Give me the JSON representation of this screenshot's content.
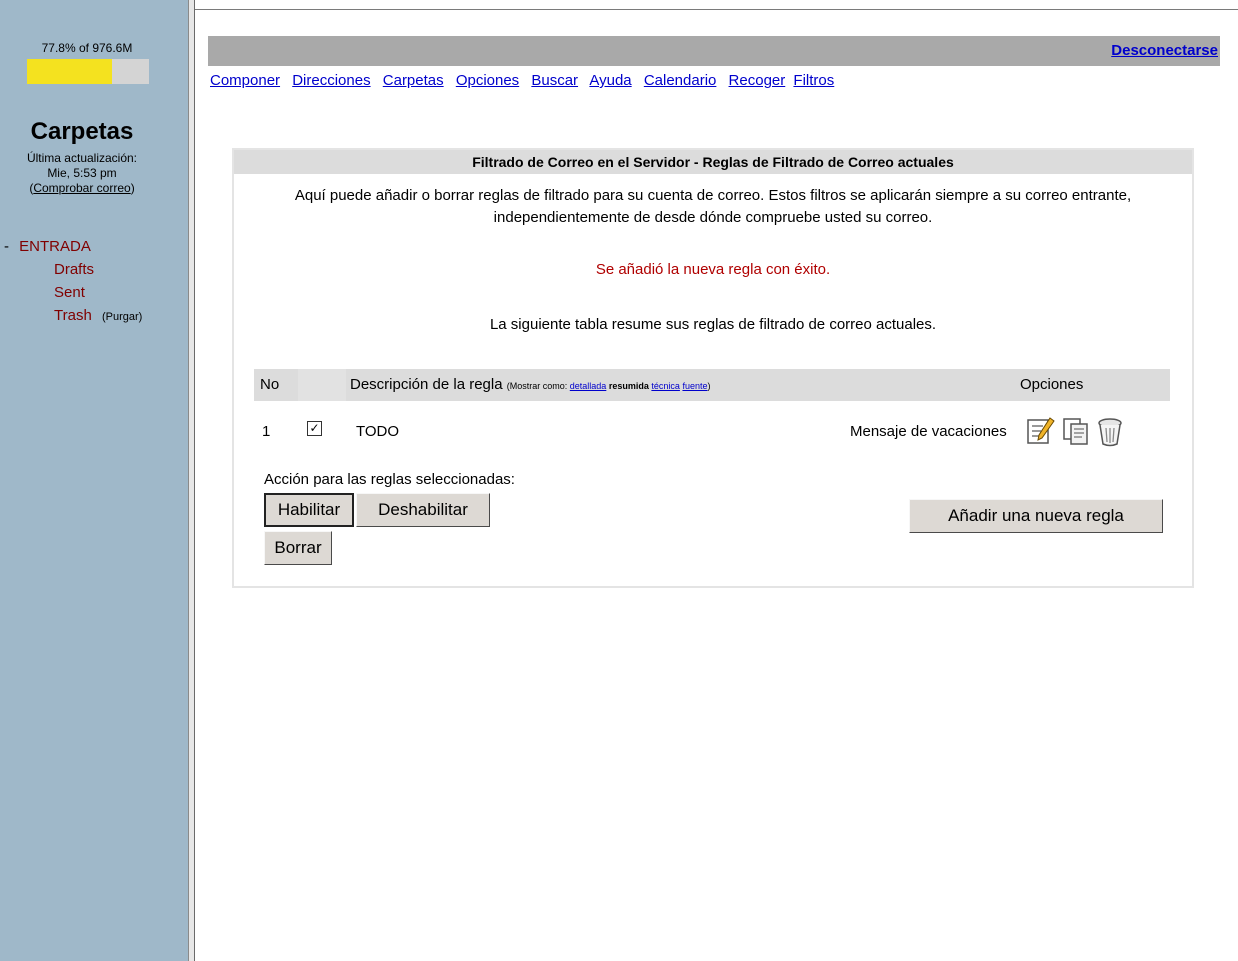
{
  "sidebar": {
    "quota_text": "77.8% of 976.6M",
    "quota_used_fraction": 0.778,
    "folders_title": "Carpetas",
    "last_update_label": "Última actualización:",
    "last_update_time": "Mie, 5:53 pm",
    "check_mail_open": "(",
    "check_mail_link": "Comprobar correo",
    "check_mail_close": ")",
    "collapse_symbol": "-",
    "folders": [
      {
        "label": "ENTRADA"
      },
      {
        "label": "Drafts"
      },
      {
        "label": "Sent"
      },
      {
        "label": "Trash",
        "purge_label": "Purgar"
      }
    ]
  },
  "header": {
    "logout_label": "Desconectarse"
  },
  "menu": [
    {
      "label": "Componer"
    },
    {
      "label": "Direcciones"
    },
    {
      "label": "Carpetas"
    },
    {
      "label": "Opciones"
    },
    {
      "label": "Buscar"
    },
    {
      "label": "Ayuda"
    },
    {
      "label": "Calendario"
    },
    {
      "label": "Recoger"
    },
    {
      "label": "Filtros"
    }
  ],
  "filters": {
    "title": "Filtrado de Correo en el Servidor - Reglas de Filtrado de Correo actuales",
    "intro_line1": "Aquí puede añadir o borrar reglas de filtrado para su cuenta de correo. Estos filtros se aplicarán siempre a su correo entrante,",
    "intro_line2": "independientemente de desde dónde compruebe usted su correo.",
    "success_message": "Se añadió la nueva regla con éxito.",
    "summary_text": "La siguiente tabla resume sus reglas de filtrado de correo actuales.",
    "table": {
      "col_no": "No",
      "col_description": "Descripción de la regla",
      "show_as_label": "(Mostrar como:",
      "view_detailed": "detallada",
      "view_summary": "resumida",
      "view_technical": "técnica",
      "view_source": "fuente",
      "show_as_close": ")",
      "col_options": "Opciones"
    },
    "rules": [
      {
        "no": "1",
        "checked": true,
        "name": "TODO",
        "action": "Mensaje de vacaciones"
      }
    ],
    "selected_actions_label": "Acción para las reglas seleccionadas:",
    "btn_enable": "Habilitar",
    "btn_disable": "Deshabilitar",
    "btn_delete": "Borrar",
    "btn_add_rule": "Añadir una nueva regla"
  },
  "icons": {
    "edit": "edit-icon",
    "copy": "copy-icon",
    "delete": "trash-icon"
  },
  "colors": {
    "sidebar_bg": "#9fb8c9",
    "quota_fill": "#f4e21f",
    "success_text": "#b00000",
    "folder_text": "#800000",
    "link": "#0000cc"
  }
}
